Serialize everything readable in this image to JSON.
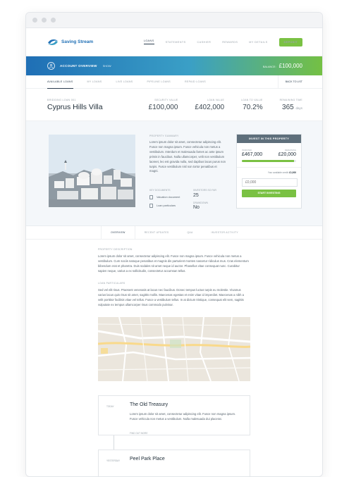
{
  "nav": {
    "logo_text": "Saving Stream",
    "menu": [
      "Loans",
      "Statements",
      "Cashier",
      "Rewards",
      "My Details"
    ],
    "deposit_label": "Deposit"
  },
  "banner": {
    "overview_label": "Account Overview",
    "show_label": "Show",
    "balance_label": "Balance:",
    "balance_value": "£100,000"
  },
  "tabs": {
    "items": [
      "Available Loans",
      "My Loans",
      "Live Loans",
      "Pipeline Loans",
      "Repaid Loans"
    ],
    "back_label": "Back to List"
  },
  "loan": {
    "id_label": "Bridging Loan 001",
    "title": "Cyprus Hills Villa",
    "stats": [
      {
        "label": "Security Value",
        "value": "£100,000",
        "unit": ""
      },
      {
        "label": "Loan Value",
        "value": "£402,000",
        "unit": ""
      },
      {
        "label": "Loan to Value",
        "value": "70.2%",
        "unit": ""
      },
      {
        "label": "Remaining Time",
        "value": "365",
        "unit": "days"
      }
    ]
  },
  "property": {
    "summary_label": "Property Summary",
    "summary_text": "Lorem ipsum dolor sit amet, consectetur adipiscing elit. Fusce non magna ipsum. Fusce vehicula non metus a vestibulum. Interdum et malesuada fames ac ante ipsum primis in faucibus. Nulla ullamcorper, velit non vestibulum laoreet, leo est gravida nulla, sed dapibus lacus purus non turpis. Fusce vestibulum nisl non tortor penatibus et magni.",
    "key_docs_label": "Key Documents",
    "docs": [
      "Valuation document",
      "Loan particulars"
    ],
    "investors_label": "Investors so far",
    "investors_value": "25",
    "drawdown_label": "Drawdown",
    "drawdown_value": "No"
  },
  "invest": {
    "header": "Invest in this property",
    "invested_label": "Invested",
    "invested_value": "£467,000",
    "remaining_label": "Remaining",
    "remaining_value": "£20,000",
    "progress_pct": 96,
    "available_label": "Your available credit:",
    "available_value": "£1,000",
    "input_placeholder": "£0,000",
    "button_label": "Start Investing"
  },
  "subtabs": [
    "Overview",
    "Recent Updates",
    "Q&A",
    "Investor Activity"
  ],
  "content": {
    "desc_label": "Property Description",
    "desc_text": "Lorem ipsum dolor sit amet, consectetur adipiscing elit. Fusce non magna ipsum. Fusce vehicula non metus a vestibulum. Cum sociis natoque penatibus et magnis dis parturient montes nascetur ridiculus mus. Cras elementum bibendum erat et pharetra. Duis sodales sit amet neque id auctor. Phasellus vitae consequat nunc. Curabitur sapien neque, varius a ex sollicitudin, consectetur accumsan tellus.",
    "particulars_label": "Loan Particulars",
    "particulars_text": "Sed vel elit risus. Praesent venenatis at lacus nec faucibus. Donec tempus luctus turpis eu molestie. Vivamus varius lacus quis risus sit amet, sagittis mollis. Maecenas egestas et enim vitae id imperdiet. Maecenas a nibh a velit porttitor facilisis vitae vel tellus. Fusce a vestibulum tellus. In at dictum tristique, consequat elit sem, sagittis vulputate ex tempus ullamcorper risus commodo pulvinar."
  },
  "places": [
    {
      "when": "Today",
      "name": "The Old Treasury",
      "desc": "Lorem ipsum dolor sit amet, consectetur adipiscing elit. Fusce non magna ipsum. Fusce vehicula non metus a vestibulum. Nulla malesuada dui placerat.",
      "more": "Find out more"
    },
    {
      "when": "Yesterday",
      "name": "Peel Park Place"
    }
  ]
}
